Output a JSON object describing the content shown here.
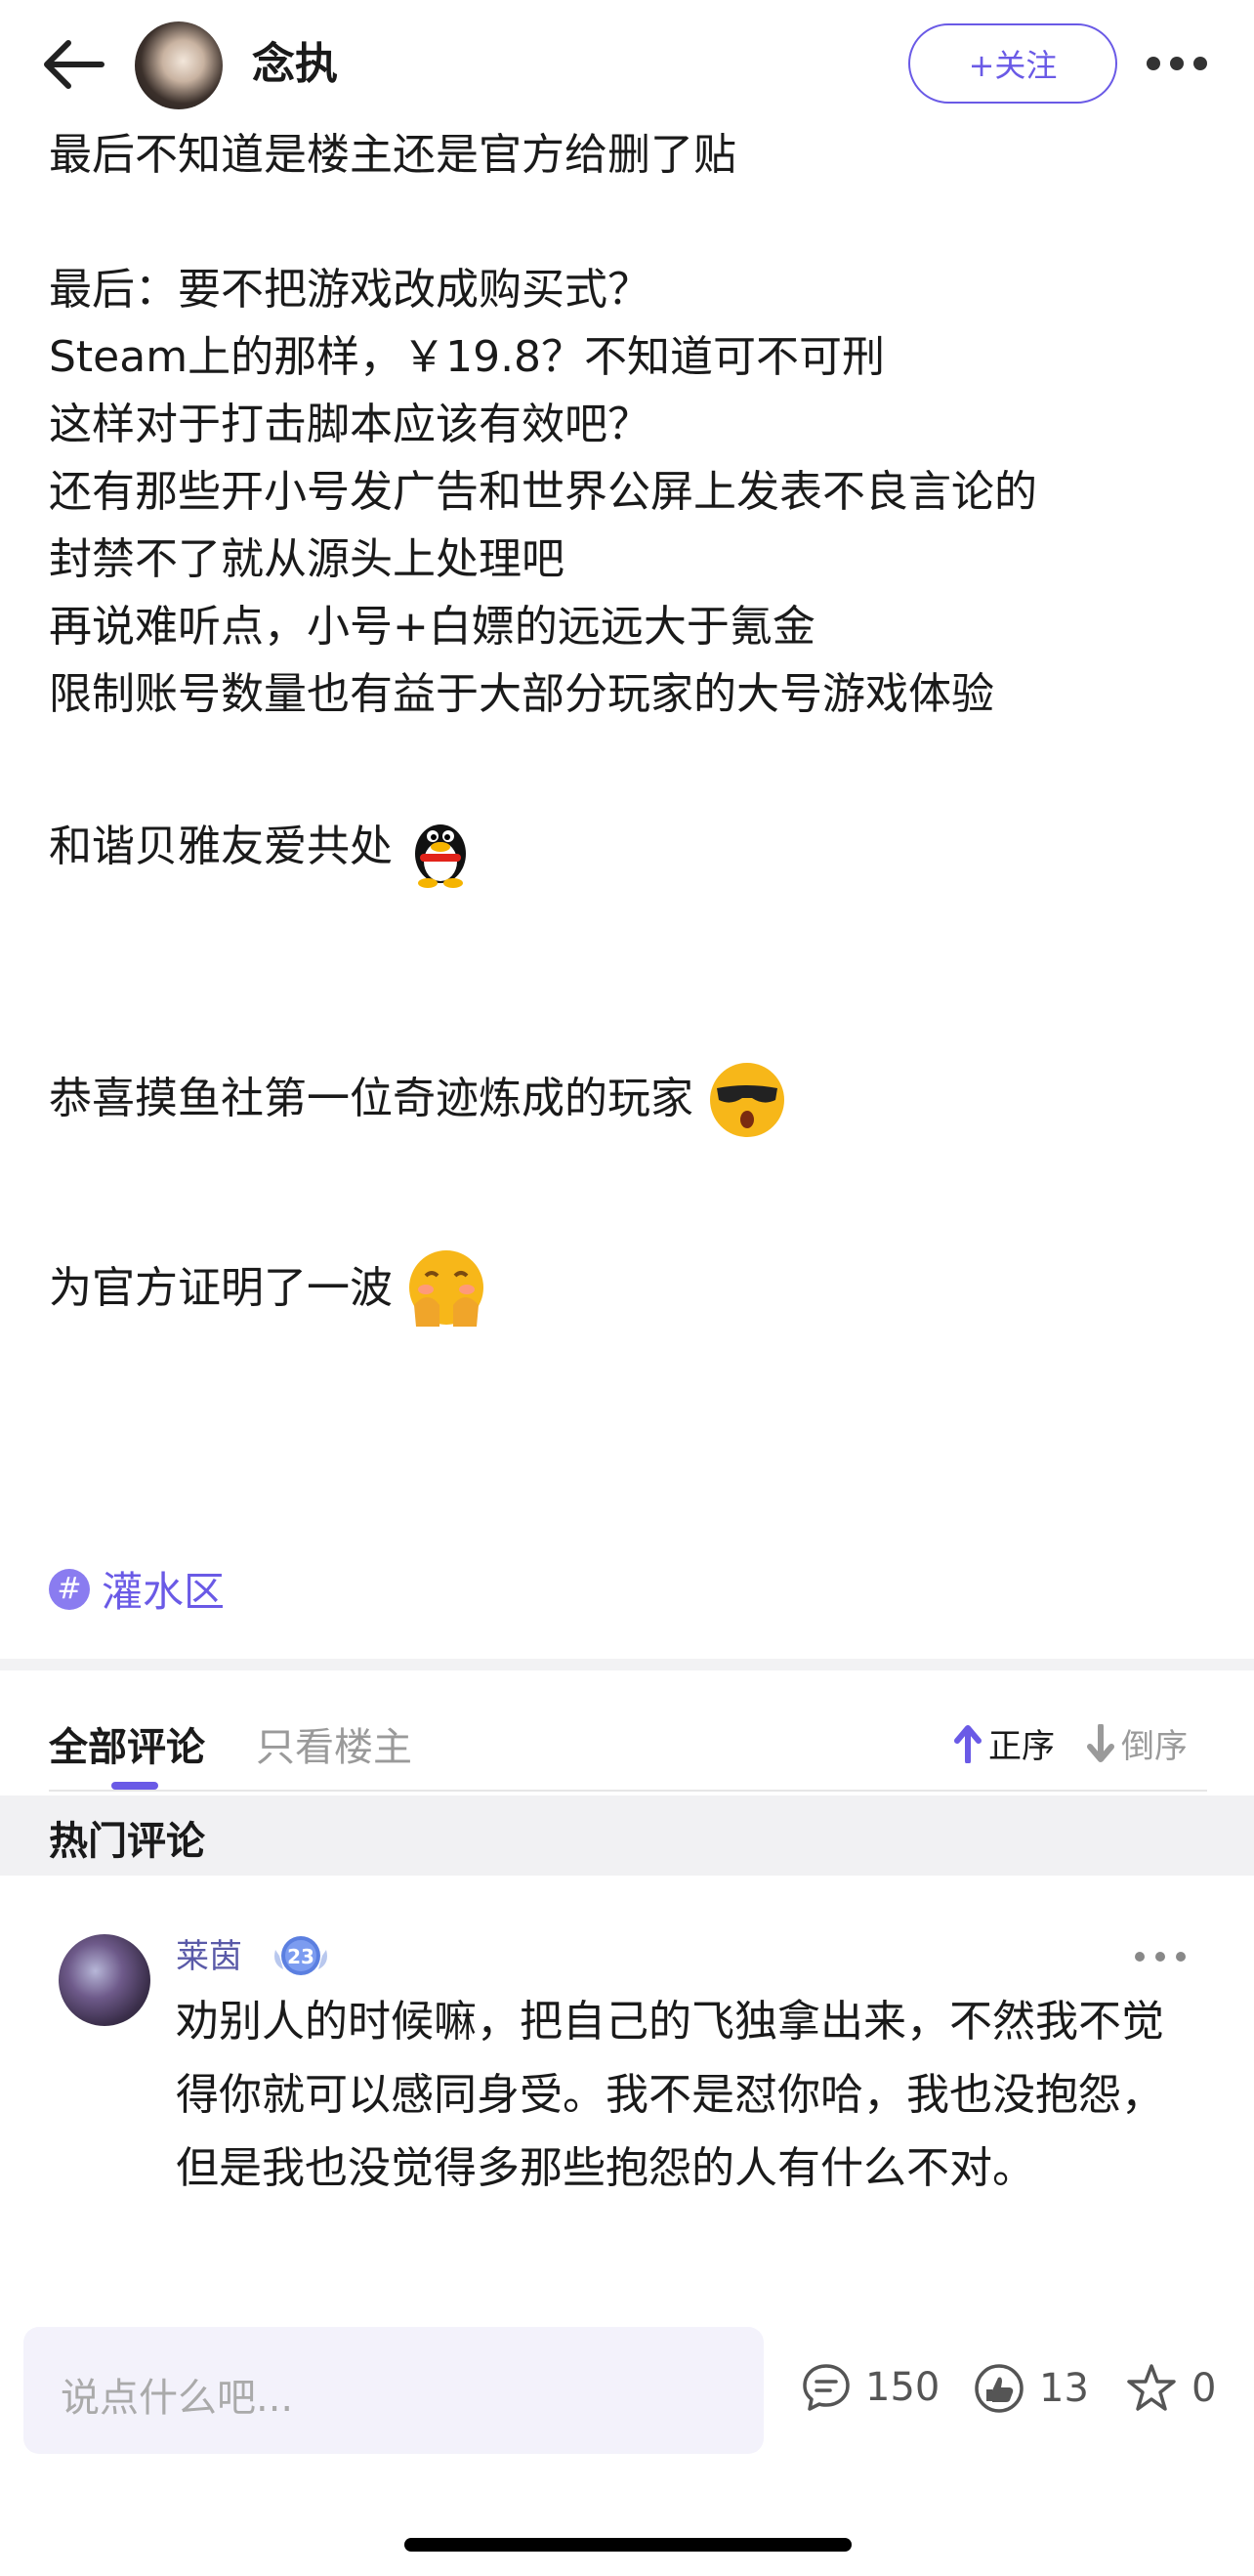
{
  "header": {
    "back_icon": "back-arrow-icon",
    "username": "念执",
    "follow_label": "+关注",
    "more_icon": "more-dots-icon"
  },
  "post": {
    "lines": [
      "最后不知道是楼主还是官方给删了贴",
      "",
      "最后：要不把游戏改成购买式？",
      "Steam上的那样，￥19.8？不知道可不可刑",
      "这样对于打击脚本应该有效吧？",
      "还有那些开小号发广告和世界公屏上发表不良言论的",
      "封禁不了就从源头上处理吧",
      "再说难听点，小号+白嫖的远远大于氪金",
      "限制账号数量也有益于大部分玩家的大号游戏体验"
    ],
    "line_harmony": "和谐贝雅友爱共处",
    "line_congrats": "恭喜摸鱼社第一位奇迹炼成的玩家",
    "line_proof": "为官方证明了一波",
    "emojis": [
      "penguin-emoji",
      "cool-sunglasses-emoji",
      "shy-covering-face-emoji"
    ]
  },
  "tag": {
    "icon": "hash-icon",
    "label": "灌水区"
  },
  "comments_section": {
    "tab_all": "全部评论",
    "tab_owner": "只看楼主",
    "sort_asc": "正序",
    "sort_desc": "倒序",
    "hot_title": "热门评论",
    "hot_comment": {
      "name": "莱茵",
      "level": "23",
      "text": "劝别人的时候嘛，把自己的飞独拿出来，不然我不觉得你就可以感同身受。我不是怼你哈，我也没抱怨，但是我也没觉得多那些抱怨的人有什么不对。"
    }
  },
  "bottom_bar": {
    "placeholder": "说点什么吧...",
    "comment_count": "150",
    "like_count": "13",
    "favorite_count": "0"
  },
  "colors": {
    "accent": "#6a5ae6"
  }
}
